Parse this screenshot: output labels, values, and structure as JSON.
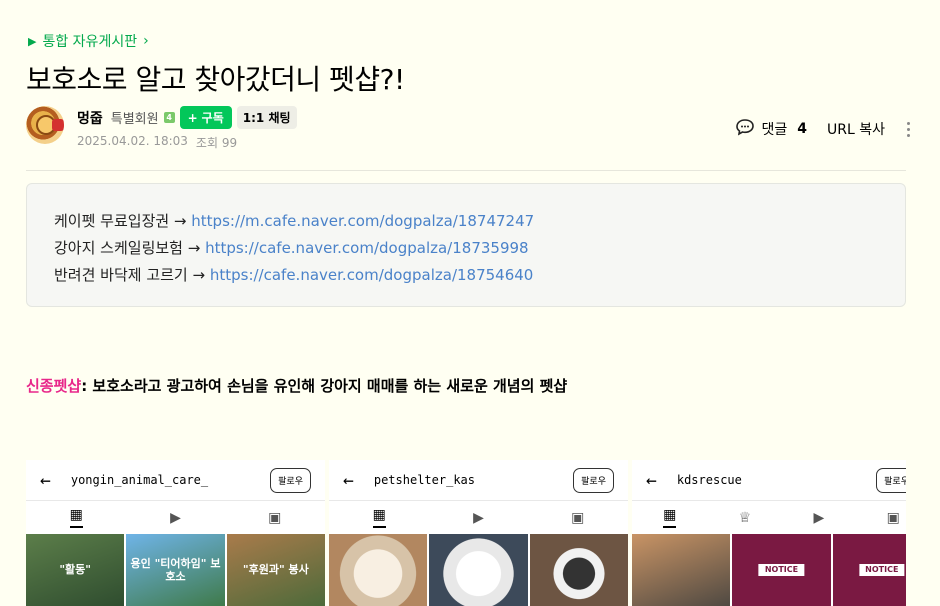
{
  "board": {
    "label": "통합 자유게시판",
    "chevron": "›"
  },
  "post": {
    "title": "보호소로 알고 찾아갔더니 펫샵?!",
    "author": {
      "nick": "멍줍",
      "grade": "특별회원",
      "grade_icon": "4"
    },
    "subscribe_label": "구독",
    "chat_label": "1:1 채팅",
    "date": "2025.04.02. 18:03",
    "views_label": "조회 99",
    "comments_label": "댓글",
    "comments_count": "4",
    "url_copy_label": "URL 복사"
  },
  "quote": {
    "lines": [
      {
        "text": "케이펫 무료입장권 → ",
        "link": "https://m.cafe.naver.com/dogpalza/18747247"
      },
      {
        "text": "강아지 스케일링보험 → ",
        "link": "https://cafe.naver.com/dogpalza/18735998"
      },
      {
        "text": "반려견 바닥제 고르기 → ",
        "link": "https://cafe.naver.com/dogpalza/18754640"
      }
    ]
  },
  "headline": {
    "highlight": "신종펫샵",
    "text": ": 보호소라고 광고하여 손님을 유인해 강아지 매매를 하는 새로운 개념의 펫샵"
  },
  "screenshots": [
    {
      "account": "yongin_animal_care_",
      "follow": "팔로우",
      "cells": [
        "\"활동\"",
        "용인 \"티어하임\" 보호소",
        "\"후원과\" 봉사"
      ]
    },
    {
      "account": "petshelter_kas",
      "follow": "팔로우",
      "cells": [
        "",
        "",
        ""
      ]
    },
    {
      "account": "kdsrescue",
      "follow": "팔로우",
      "cells": [
        "",
        "NOTICE",
        "NOTICE"
      ]
    }
  ],
  "colors": {
    "accent_green": "#03c75a",
    "board_green": "#03a94d",
    "link_blue": "#4a82c9",
    "highlight_pink": "#e8278a"
  }
}
